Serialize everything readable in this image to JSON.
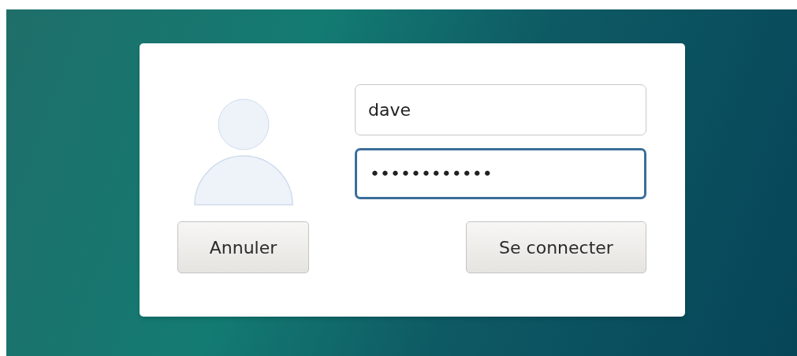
{
  "login": {
    "username": {
      "value": "dave",
      "focused": false
    },
    "password": {
      "value": "••••••••••••",
      "focused": true
    },
    "buttons": [
      {
        "label": "Annuler",
        "kind": "cancel"
      },
      {
        "label": "Se connecter",
        "kind": "submit"
      }
    ]
  }
}
